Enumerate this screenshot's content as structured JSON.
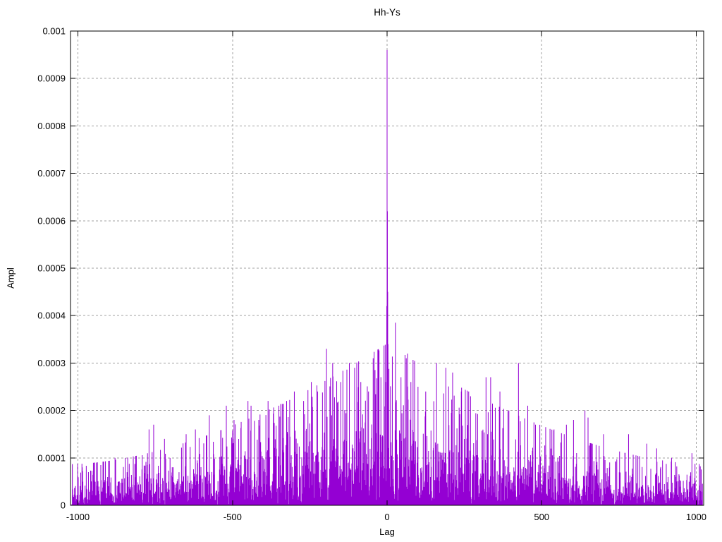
{
  "window": {
    "background": "#ffffff"
  },
  "chart_data": {
    "type": "impulses",
    "title": "Hh-Ys",
    "xlabel": "Lag",
    "ylabel": "Ampl",
    "xlim": [
      -1024,
      1024
    ],
    "ylim": [
      0,
      0.001
    ],
    "grid": true,
    "legend": "none",
    "line_color": "#9400d3",
    "grid_color": "#a0a0a0",
    "border_color": "#000000",
    "xticks": [
      {
        "value": -1000,
        "label": "-1000"
      },
      {
        "value": -500,
        "label": "-500"
      },
      {
        "value": 0,
        "label": "0"
      },
      {
        "value": 500,
        "label": "500"
      },
      {
        "value": 1000,
        "label": "1000"
      }
    ],
    "yticks": [
      {
        "value": 0,
        "label": "0"
      },
      {
        "value": 0.0001,
        "label": "0.0001"
      },
      {
        "value": 0.0002,
        "label": "0.0002"
      },
      {
        "value": 0.0003,
        "label": "0.0003"
      },
      {
        "value": 0.0004,
        "label": "0.0004"
      },
      {
        "value": 0.0005,
        "label": "0.0005"
      },
      {
        "value": 0.0006,
        "label": "0.0006"
      },
      {
        "value": 0.0007,
        "label": "0.0007"
      },
      {
        "value": 0.0008,
        "label": "0.0008"
      },
      {
        "value": 0.0009,
        "label": "0.0009"
      },
      {
        "value": 0.001,
        "label": "0.001"
      }
    ],
    "description": "Noisy impulse plot of correlation amplitude vs lag; triangular noise envelope rising toward lag 0 with a dominant sharp spike at lag 0 of about 0.00096.",
    "main_peak": {
      "lag": 0,
      "ampl": 0.00096
    },
    "notable_peaks": [
      [
        -986,
        8e-05
      ],
      [
        -940,
        9e-05
      ],
      [
        -880,
        0.0001
      ],
      [
        -770,
        0.00016
      ],
      [
        -755,
        0.00017
      ],
      [
        -720,
        0.00014
      ],
      [
        -650,
        0.00015
      ],
      [
        -620,
        0.00016
      ],
      [
        -575,
        0.00019
      ],
      [
        -520,
        0.00021
      ],
      [
        -495,
        0.00018
      ],
      [
        -450,
        0.00022
      ],
      [
        -440,
        0.00021
      ],
      [
        -415,
        0.00018
      ],
      [
        -385,
        0.00022
      ],
      [
        -350,
        0.00021
      ],
      [
        -325,
        0.00022
      ],
      [
        -300,
        0.00024
      ],
      [
        -270,
        0.00022
      ],
      [
        -245,
        0.00026
      ],
      [
        -225,
        0.00024
      ],
      [
        -196,
        0.00033
      ],
      [
        -176,
        0.0003
      ],
      [
        -150,
        0.00026
      ],
      [
        -122,
        0.0003
      ],
      [
        -105,
        0.00029
      ],
      [
        -85,
        0.00026
      ],
      [
        -60,
        0.00024
      ],
      [
        -45,
        0.00031
      ],
      [
        -20,
        0.00027
      ],
      [
        -5,
        0.00026
      ],
      [
        -1,
        0.00042
      ],
      [
        0,
        0.00096
      ],
      [
        1,
        0.00062
      ],
      [
        2,
        0.00045
      ],
      [
        27,
        0.000385
      ],
      [
        45,
        0.00027
      ],
      [
        62,
        0.00031
      ],
      [
        66,
        0.00032
      ],
      [
        77,
        0.00026
      ],
      [
        100,
        0.00025
      ],
      [
        125,
        0.00024
      ],
      [
        160,
        0.0003
      ],
      [
        190,
        0.00029
      ],
      [
        212,
        0.00028
      ],
      [
        240,
        0.00024
      ],
      [
        270,
        0.00023
      ],
      [
        320,
        0.00027
      ],
      [
        335,
        0.00027
      ],
      [
        365,
        0.00024
      ],
      [
        394,
        0.0002
      ],
      [
        425,
        0.0003
      ],
      [
        455,
        0.00021
      ],
      [
        480,
        0.00017
      ],
      [
        540,
        0.00016
      ],
      [
        580,
        0.00017
      ],
      [
        603,
        0.00018
      ],
      [
        640,
        0.0002
      ],
      [
        650,
        0.000185
      ],
      [
        700,
        0.00015
      ],
      [
        781,
        0.00015
      ],
      [
        840,
        0.00013
      ],
      [
        872,
        0.00012
      ],
      [
        920,
        0.0001
      ],
      [
        986,
        0.00011
      ]
    ],
    "noise_model": {
      "seed": 7,
      "lag_min": -1020,
      "lag_max": 1020,
      "base": 2.8e-05,
      "range": 8.2e-05,
      "shape_exponent": 1.7,
      "cap_multiplier": 3.1
    }
  }
}
